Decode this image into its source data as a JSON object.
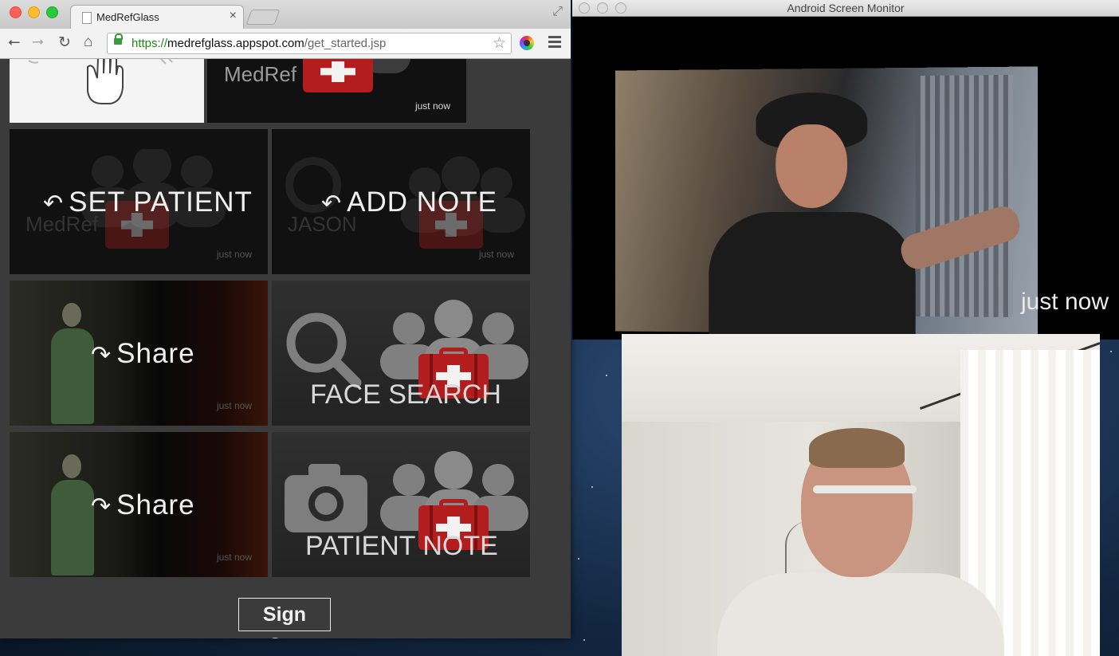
{
  "browser": {
    "tab_title": "MedRefGlass",
    "tab_close": "×",
    "url": {
      "scheme": "https://",
      "host": "medrefglass.appspot.com",
      "path": "/get_started.jsp"
    }
  },
  "cards": {
    "top_card": {
      "label": "MedRef",
      "time": "just now"
    },
    "set_patient": {
      "label": "SET PATIENT",
      "faint": "MedRef",
      "time": "just now"
    },
    "add_note": {
      "label": "ADD NOTE",
      "faint": "JASON",
      "time": "just now"
    },
    "share_1": {
      "label": "Share",
      "time": "just now"
    },
    "face_search": {
      "label": "FACE SEARCH"
    },
    "share_2": {
      "label": "Share",
      "time": "just now"
    },
    "patient_note": {
      "label": "PATIENT NOTE"
    }
  },
  "signout": {
    "label": "Sign Out"
  },
  "monitor": {
    "title": "Android Screen Monitor",
    "time": "just now"
  },
  "colors": {
    "card_bg": "#111111",
    "kit_red": "#b31d1d",
    "page_bg": "#3b3b3b"
  }
}
